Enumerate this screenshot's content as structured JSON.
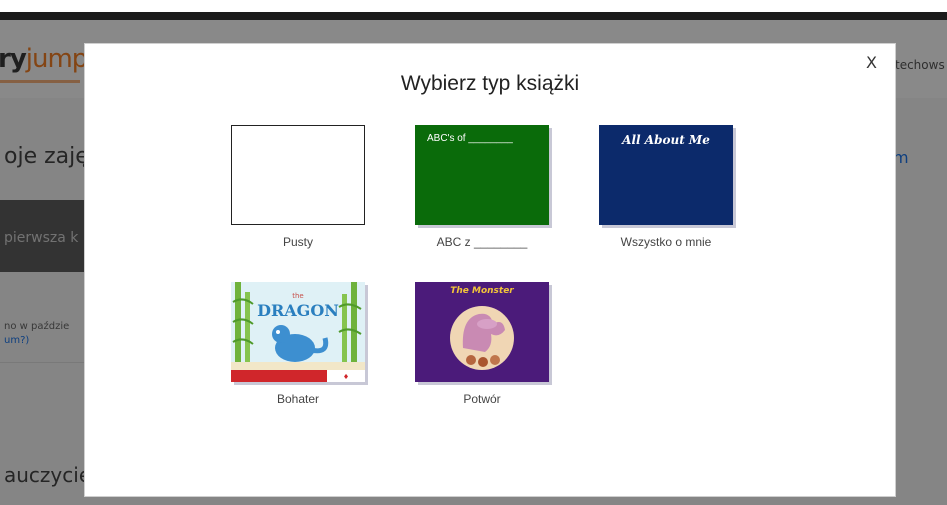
{
  "background": {
    "logo_part1": "ry",
    "logo_part2": "jumpe",
    "teacher_name": "techows",
    "title": "oje zaję",
    "link_right": "m",
    "dark_block_text": "pierwsza k",
    "small_text_line1": "no w paździe",
    "small_text_line2": "um?)",
    "bottom_title": "auczycie"
  },
  "modal": {
    "close_label": "X",
    "title": "Wybierz typ książki",
    "options": [
      {
        "label": "Pusty"
      },
      {
        "label": "ABC z ________",
        "cover_text": "ABC's of ________"
      },
      {
        "label": "Wszystko o mnie",
        "cover_text": "All About Me"
      },
      {
        "label": "Bohater",
        "cover_text": "DRAGON"
      },
      {
        "label": "Potwór",
        "cover_text": "The Monster"
      }
    ]
  },
  "colors": {
    "accent_orange": "#f07e26",
    "abc_green": "#0a6b0a",
    "about_navy": "#0c2a6b",
    "monster_purple": "#4b1b7a"
  }
}
